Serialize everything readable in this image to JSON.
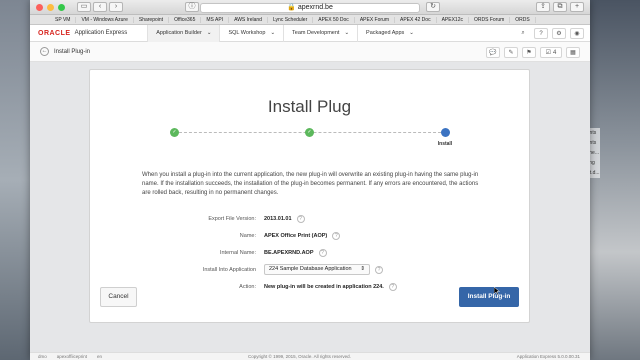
{
  "browser": {
    "url": "apexrnd.be",
    "bookmarks": [
      "SP VM",
      "VM - Windows Azure",
      "Sharepoint",
      "Office365",
      "MS API",
      "AWS Ireland",
      "Lync Scheduler",
      "APEX 50 Doc",
      "APEX Forum",
      "APEX 42 Doc",
      "APEX12c",
      "ORDS Forum",
      "ORDS"
    ]
  },
  "apex": {
    "logo": "ORACLE",
    "product": "Application Express",
    "tabs": [
      "Application Builder",
      "SQL Workshop",
      "Team Development",
      "Packaged Apps"
    ],
    "badge_count": "4"
  },
  "breadcrumb": {
    "label": "Install Plug-in"
  },
  "dialog": {
    "title": "Install Plug",
    "steps": [
      "",
      "",
      "Install"
    ],
    "description": "When you install a plug-in into the current application, the new plug-in will overwrite an existing plug-in having the same plug-in name. If the installation succeeds, the installation of the plug-in becomes permanent. If any errors are encountered, the actions are rolled back, resulting in no permanent changes.",
    "fields": {
      "export_version_label": "Export File Version:",
      "export_version_value": "2013.01.01",
      "name_label": "Name:",
      "name_value": "APEX Office Print (AOP)",
      "internal_label": "Internal Name:",
      "internal_value": "BE.APEXRND.AOP",
      "app_label": "Install Into Application",
      "app_value": "224 Sample Database Application",
      "action_label": "Action:",
      "action_value": "New plug-in will be created in application 224."
    },
    "cancel_label": "Cancel",
    "install_label": "Install Plug-in"
  },
  "footer": {
    "left1": "dmo",
    "left2": "apexoffiiceprint",
    "left3": "en",
    "copyright": "Copyright © 1999, 2015, Oracle. All rights reserved.",
    "version": "Application Express 5.0.0.00.31"
  },
  "side_texts": [
    "....nts",
    "....nts",
    "dshe...",
    "...ing",
    "...rt.d..."
  ],
  "colors": {
    "oracle_red": "#d7251f",
    "primary_blue": "#3566a8",
    "step_done": "#5cb85c",
    "step_current": "#3b73c2"
  }
}
